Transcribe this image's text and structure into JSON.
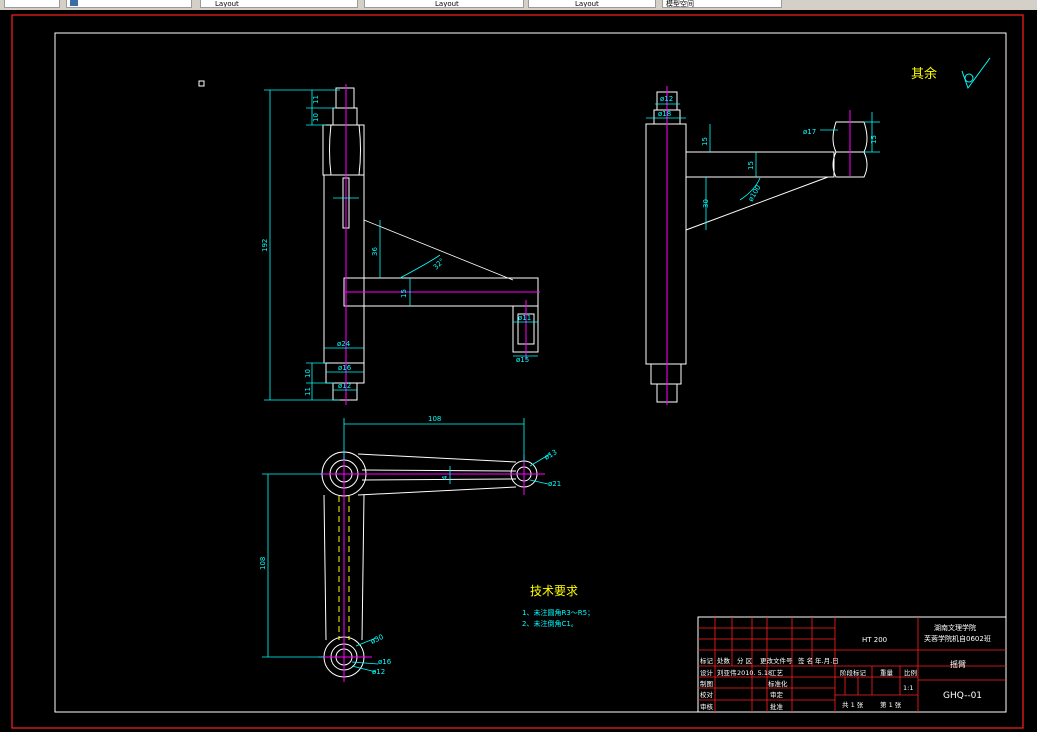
{
  "toolbar": {
    "tabs": [
      {
        "label": ""
      },
      {
        "label": "Layout"
      },
      {
        "label": "Layout"
      },
      {
        "label": "Layout"
      },
      {
        "label": "模型空间"
      }
    ]
  },
  "drawing": {
    "surface_note": "其余",
    "tech_title": "技术要求",
    "tech_items": [
      "1、未注圆角R3～R5；",
      "2、未注倒角C1。"
    ],
    "dims_front": [
      "11",
      "10",
      "192",
      "ø24",
      "ø16",
      "10",
      "ø12",
      "11",
      "36",
      "32°",
      "15",
      "ø11",
      "ø15"
    ],
    "dims_side": [
      "ø12",
      "ø18",
      "ø17",
      "15",
      "15",
      "15",
      "ø100",
      "30"
    ],
    "dims_top": [
      "108",
      "ø13",
      "ø21",
      "4",
      "108",
      "ø30",
      "ø16",
      "ø12"
    ]
  },
  "title_block": {
    "material": "HT 200",
    "school": "湖南文理学院",
    "class_name": "芙蓉学院机自0602班",
    "part_name": "摇臂",
    "drawing_no": "GHQ--01",
    "scale": "1:1",
    "sheet_total": "共 1 张",
    "sheet_no": "第 1 张",
    "headers": [
      "标记",
      "处数",
      "分 区",
      "更改文件号",
      "签 名",
      "年.月.日"
    ],
    "design_row": [
      "设计",
      "刘亚伟",
      "2010. 5.18",
      "工艺"
    ],
    "rows": [
      [
        "制图",
        "",
        "",
        "标准化"
      ],
      [
        "校对",
        "",
        "",
        "审定"
      ],
      [
        "审核",
        "",
        "",
        "批准"
      ]
    ],
    "stage_labels": [
      "阶段标记",
      "重量",
      "比例"
    ]
  }
}
